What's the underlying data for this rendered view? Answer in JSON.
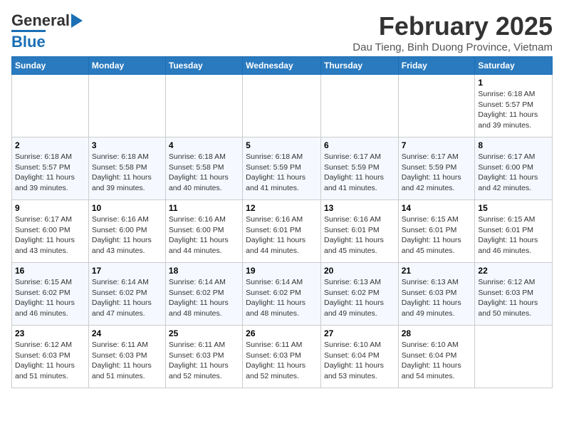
{
  "header": {
    "logo_general": "General",
    "logo_blue": "Blue",
    "title": "February 2025",
    "subtitle": "Dau Tieng, Binh Duong Province, Vietnam"
  },
  "weekdays": [
    "Sunday",
    "Monday",
    "Tuesday",
    "Wednesday",
    "Thursday",
    "Friday",
    "Saturday"
  ],
  "weeks": [
    [
      {
        "day": "",
        "info": ""
      },
      {
        "day": "",
        "info": ""
      },
      {
        "day": "",
        "info": ""
      },
      {
        "day": "",
        "info": ""
      },
      {
        "day": "",
        "info": ""
      },
      {
        "day": "",
        "info": ""
      },
      {
        "day": "1",
        "info": "Sunrise: 6:18 AM\nSunset: 5:57 PM\nDaylight: 11 hours and 39 minutes."
      }
    ],
    [
      {
        "day": "2",
        "info": "Sunrise: 6:18 AM\nSunset: 5:57 PM\nDaylight: 11 hours and 39 minutes."
      },
      {
        "day": "3",
        "info": "Sunrise: 6:18 AM\nSunset: 5:58 PM\nDaylight: 11 hours and 39 minutes."
      },
      {
        "day": "4",
        "info": "Sunrise: 6:18 AM\nSunset: 5:58 PM\nDaylight: 11 hours and 40 minutes."
      },
      {
        "day": "5",
        "info": "Sunrise: 6:18 AM\nSunset: 5:59 PM\nDaylight: 11 hours and 41 minutes."
      },
      {
        "day": "6",
        "info": "Sunrise: 6:17 AM\nSunset: 5:59 PM\nDaylight: 11 hours and 41 minutes."
      },
      {
        "day": "7",
        "info": "Sunrise: 6:17 AM\nSunset: 5:59 PM\nDaylight: 11 hours and 42 minutes."
      },
      {
        "day": "8",
        "info": "Sunrise: 6:17 AM\nSunset: 6:00 PM\nDaylight: 11 hours and 42 minutes."
      }
    ],
    [
      {
        "day": "9",
        "info": "Sunrise: 6:17 AM\nSunset: 6:00 PM\nDaylight: 11 hours and 43 minutes."
      },
      {
        "day": "10",
        "info": "Sunrise: 6:16 AM\nSunset: 6:00 PM\nDaylight: 11 hours and 43 minutes."
      },
      {
        "day": "11",
        "info": "Sunrise: 6:16 AM\nSunset: 6:00 PM\nDaylight: 11 hours and 44 minutes."
      },
      {
        "day": "12",
        "info": "Sunrise: 6:16 AM\nSunset: 6:01 PM\nDaylight: 11 hours and 44 minutes."
      },
      {
        "day": "13",
        "info": "Sunrise: 6:16 AM\nSunset: 6:01 PM\nDaylight: 11 hours and 45 minutes."
      },
      {
        "day": "14",
        "info": "Sunrise: 6:15 AM\nSunset: 6:01 PM\nDaylight: 11 hours and 45 minutes."
      },
      {
        "day": "15",
        "info": "Sunrise: 6:15 AM\nSunset: 6:01 PM\nDaylight: 11 hours and 46 minutes."
      }
    ],
    [
      {
        "day": "16",
        "info": "Sunrise: 6:15 AM\nSunset: 6:02 PM\nDaylight: 11 hours and 46 minutes."
      },
      {
        "day": "17",
        "info": "Sunrise: 6:14 AM\nSunset: 6:02 PM\nDaylight: 11 hours and 47 minutes."
      },
      {
        "day": "18",
        "info": "Sunrise: 6:14 AM\nSunset: 6:02 PM\nDaylight: 11 hours and 48 minutes."
      },
      {
        "day": "19",
        "info": "Sunrise: 6:14 AM\nSunset: 6:02 PM\nDaylight: 11 hours and 48 minutes."
      },
      {
        "day": "20",
        "info": "Sunrise: 6:13 AM\nSunset: 6:02 PM\nDaylight: 11 hours and 49 minutes."
      },
      {
        "day": "21",
        "info": "Sunrise: 6:13 AM\nSunset: 6:03 PM\nDaylight: 11 hours and 49 minutes."
      },
      {
        "day": "22",
        "info": "Sunrise: 6:12 AM\nSunset: 6:03 PM\nDaylight: 11 hours and 50 minutes."
      }
    ],
    [
      {
        "day": "23",
        "info": "Sunrise: 6:12 AM\nSunset: 6:03 PM\nDaylight: 11 hours and 51 minutes."
      },
      {
        "day": "24",
        "info": "Sunrise: 6:11 AM\nSunset: 6:03 PM\nDaylight: 11 hours and 51 minutes."
      },
      {
        "day": "25",
        "info": "Sunrise: 6:11 AM\nSunset: 6:03 PM\nDaylight: 11 hours and 52 minutes."
      },
      {
        "day": "26",
        "info": "Sunrise: 6:11 AM\nSunset: 6:03 PM\nDaylight: 11 hours and 52 minutes."
      },
      {
        "day": "27",
        "info": "Sunrise: 6:10 AM\nSunset: 6:04 PM\nDaylight: 11 hours and 53 minutes."
      },
      {
        "day": "28",
        "info": "Sunrise: 6:10 AM\nSunset: 6:04 PM\nDaylight: 11 hours and 54 minutes."
      },
      {
        "day": "",
        "info": ""
      }
    ]
  ]
}
